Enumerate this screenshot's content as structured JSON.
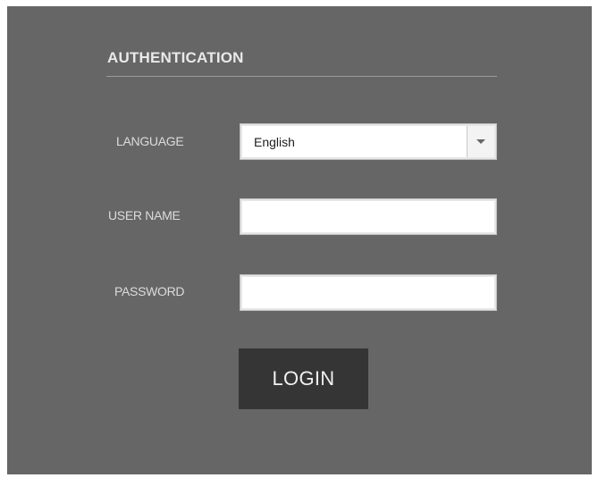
{
  "auth": {
    "title": "AUTHENTICATION",
    "language": {
      "label": "LANGUAGE",
      "selected": "English",
      "dropdown_icon": "chevron-down-icon"
    },
    "username": {
      "label": "USER NAME",
      "value": ""
    },
    "password": {
      "label": "PASSWORD",
      "value": ""
    },
    "login_button": "LOGIN"
  },
  "colors": {
    "panel_bg": "#666666",
    "button_bg": "#353535",
    "label_text": "#dcdcdc",
    "title_text": "#e9e9e9"
  }
}
